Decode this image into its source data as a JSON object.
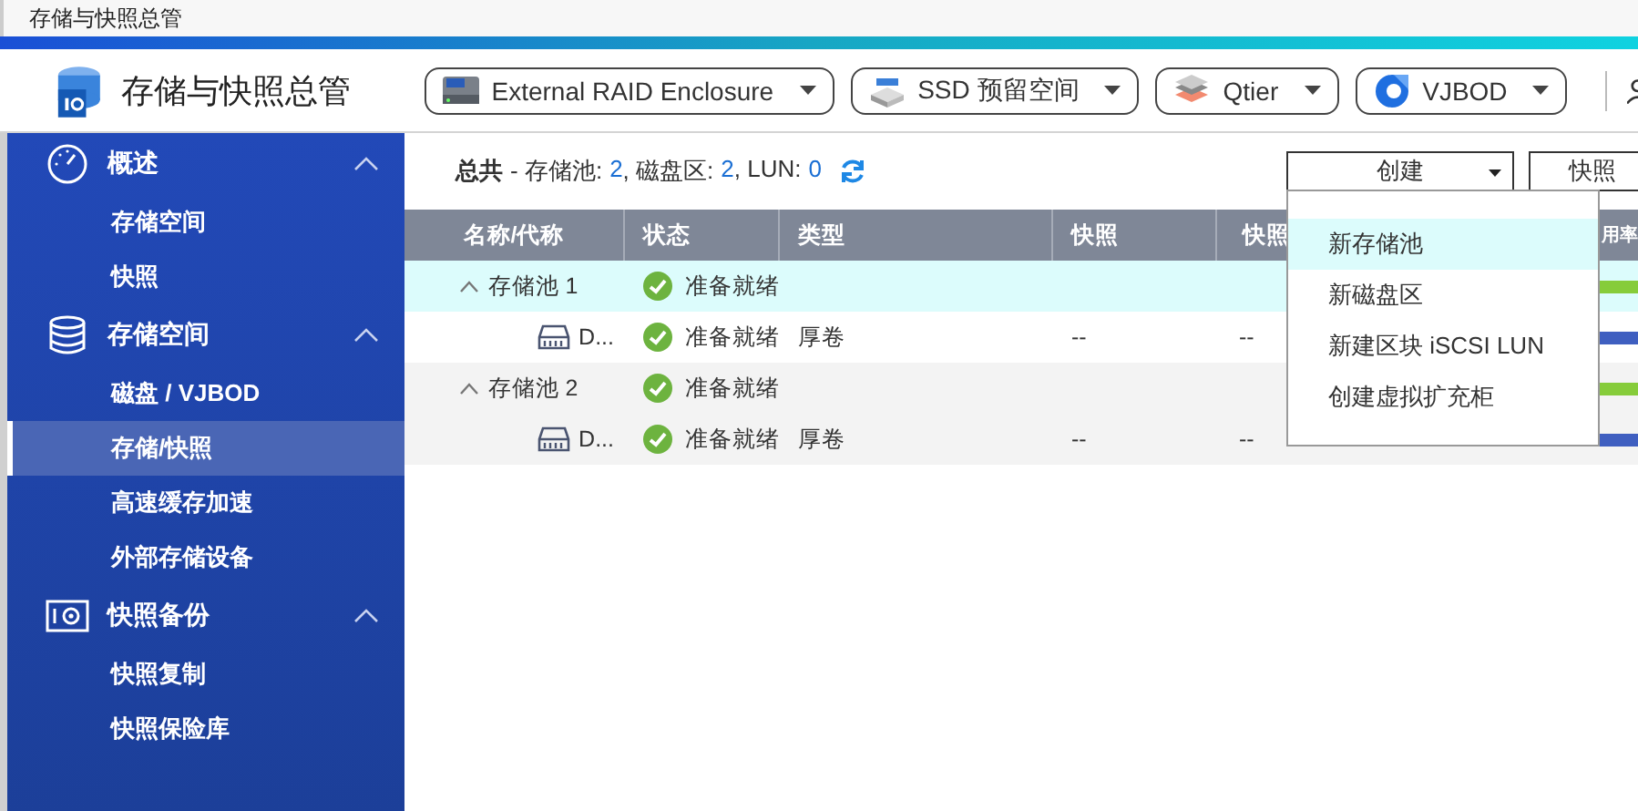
{
  "window": {
    "title": "存储与快照总管"
  },
  "app": {
    "title": "存储与快照总管"
  },
  "toolbar": [
    {
      "label": "External RAID Enclosure",
      "kind": "raid"
    },
    {
      "label": "SSD 预留空间",
      "kind": "ssd"
    },
    {
      "label": "Qtier",
      "kind": "qtier"
    },
    {
      "label": "VJBOD",
      "kind": "vjbod"
    }
  ],
  "sidebar": {
    "sections": [
      {
        "title": "概述",
        "kind": "gauge",
        "expanded": true,
        "items": [
          {
            "label": "存储空间",
            "selected": false
          },
          {
            "label": "快照",
            "selected": false
          }
        ]
      },
      {
        "title": "存储空间",
        "kind": "database",
        "expanded": true,
        "items": [
          {
            "label": "磁盘 / VJBOD",
            "selected": false
          },
          {
            "label": "存储/快照",
            "selected": true
          },
          {
            "label": "高速缓存加速",
            "selected": false
          },
          {
            "label": "外部存储设备",
            "selected": false
          }
        ]
      },
      {
        "title": "快照备份",
        "kind": "camera",
        "expanded": true,
        "items": [
          {
            "label": "快照复制",
            "selected": false
          },
          {
            "label": "快照保险库",
            "selected": false
          }
        ]
      }
    ]
  },
  "summary": {
    "label": "总共",
    "parts": [
      {
        "label": "- 存储池:",
        "value": "2"
      },
      {
        "label": ", 磁盘区:",
        "value": "2"
      },
      {
        "label": ", LUN:",
        "value": "0"
      }
    ]
  },
  "actions": [
    {
      "label": "创建",
      "kind": "dropdown"
    },
    {
      "label": "快照",
      "kind": "button"
    }
  ],
  "table": {
    "columns": [
      "名称/代称",
      "状态",
      "类型",
      "快照",
      "快照",
      "用率"
    ],
    "rows": [
      {
        "kind": "pool",
        "expanded": true,
        "selected": true,
        "name": "存储池 1",
        "status": "准备就绪"
      },
      {
        "kind": "volume",
        "selected": false,
        "name": "D...",
        "status": "准备就绪",
        "type": "厚卷",
        "snapshot": "--",
        "column_5": "--"
      },
      {
        "kind": "pool",
        "expanded": true,
        "selected": false,
        "name": "存储池 2",
        "status": "准备就绪"
      },
      {
        "kind": "volume",
        "selected": false,
        "name": "D...",
        "status": "准备就绪",
        "type": "厚卷",
        "snapshot": "--",
        "column_5": "--"
      }
    ]
  },
  "create_menu": [
    {
      "label": "新存储池",
      "selected": true
    },
    {
      "label": "新磁盘区",
      "selected": false
    },
    {
      "label": "新建区块 iSCSI LUN",
      "selected": false
    },
    {
      "label": "创建虚拟扩充柜",
      "selected": false
    }
  ]
}
